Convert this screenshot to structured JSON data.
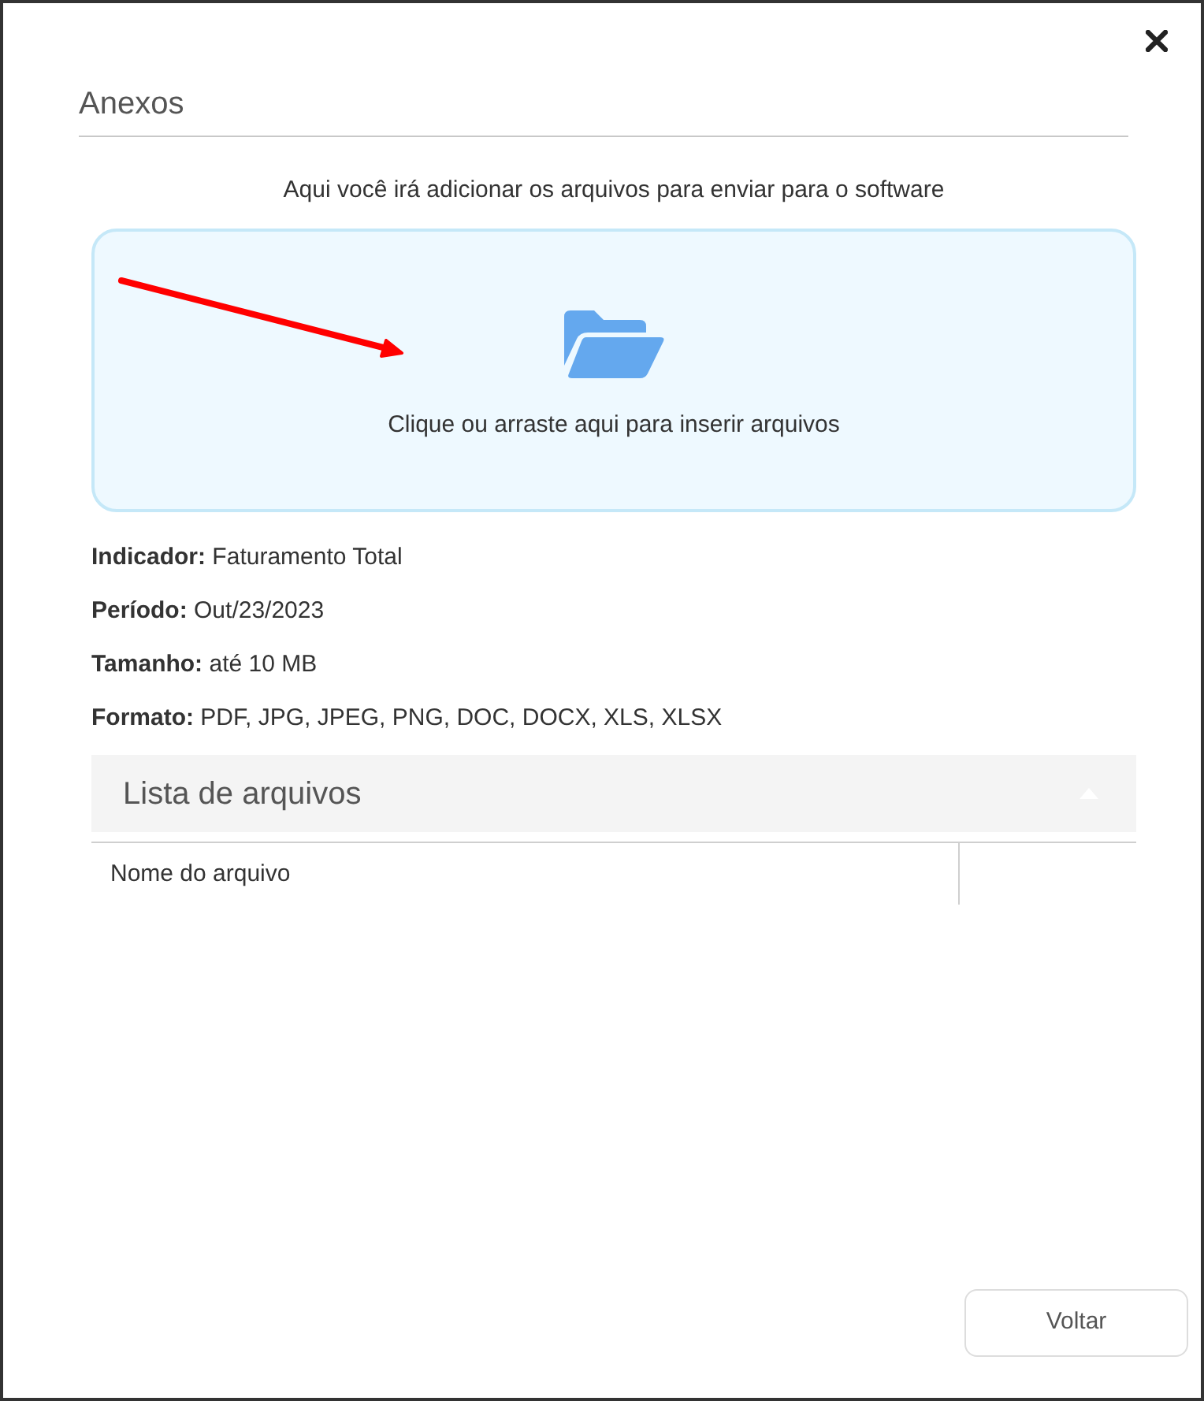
{
  "dialog": {
    "title": "Anexos"
  },
  "intro": "Aqui você irá adicionar os arquivos para enviar para o software",
  "dropzone": {
    "text": "Clique ou arraste aqui para inserir arquivos"
  },
  "details": [
    "**Indicador:** Faturamento Total",
    "**Período:** Out/23/2023",
    "**Tamanho:** até 10 MB",
    "**Formato:** PDF, JPG, JPEG, PNG, DOC, DOCX, XLS, XLSX"
  ],
  "file_list": {
    "title": "Lista de arquivos",
    "expanded": true,
    "columns": [
      "Nome do arquivo"
    ]
  },
  "buttons": [
    "Voltar"
  ]
}
